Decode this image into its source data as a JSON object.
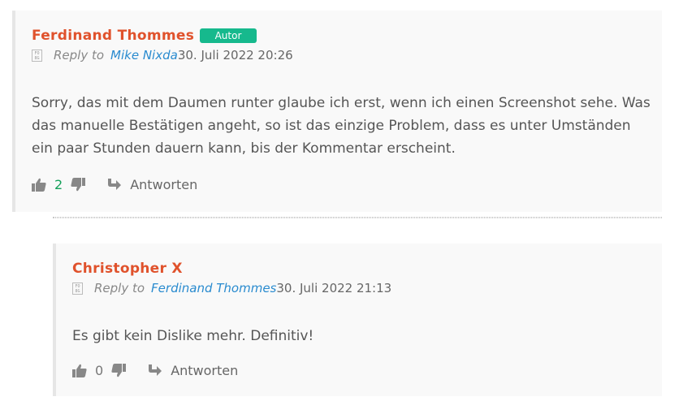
{
  "comments": [
    {
      "author": "Ferdinand Thommes",
      "badge": "Autor",
      "reply_label": "Reply to",
      "reply_to": "Mike Nixda",
      "date": "30. Juli 2022 20:26",
      "text": "Sorry, das mit dem Daumen runter glaube ich erst, wenn ich einen Screenshot sehe. Was das manuelle Bestätigen angeht, so ist das einzige Problem, dass es unter Umständen ein paar Stunden dauern kann, bis der Kommentar erscheint.",
      "likes": "2",
      "answer_label": "Antworten"
    },
    {
      "author": "Christopher X",
      "reply_label": "Reply to",
      "reply_to": "Ferdinand Thommes",
      "date": "30. Juli 2022 21:13",
      "text": "Es gibt kein Dislike mehr. Definitiv!",
      "likes": "0",
      "answer_label": "Antworten"
    }
  ],
  "avatar_placeholder": "FO\n8G",
  "colors": {
    "author": "#e0522c",
    "badge": "#16b98d",
    "link": "#2a8bcf",
    "likes": "#14a05a"
  }
}
